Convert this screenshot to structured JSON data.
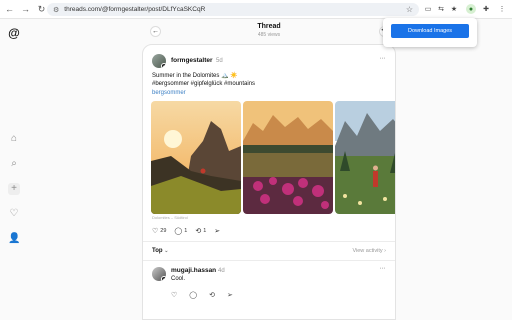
{
  "browser": {
    "url": "threads.com/@formgestalter/post/DLfYcaSKCqR",
    "back_icon": "←",
    "forward_icon": "→",
    "reload_icon": "↻",
    "tune_icon": "⚙",
    "star_icon": "☆"
  },
  "extension_popup": {
    "download_label": "Download Images"
  },
  "thread_header": {
    "title": "Thread",
    "views": "485 views"
  },
  "post": {
    "username": "formgestalter",
    "time": "5d",
    "line1": "Summer in the Dolomites 🏔️ ☀️",
    "line2": "#bergsommer #gipfelglück #mountains",
    "tag": "bergsommer",
    "caption": "Dolomites – Südtirol",
    "likes": "29",
    "comments": "1",
    "reposts": "1"
  },
  "activity": {
    "sort_label": "Top",
    "view_activity": "View activity"
  },
  "reply": {
    "username": "mugaji.hassan",
    "time": "4d",
    "text": "Cool."
  },
  "colors": {
    "accent": "#1a73e8",
    "link": "#3b7fc4"
  }
}
